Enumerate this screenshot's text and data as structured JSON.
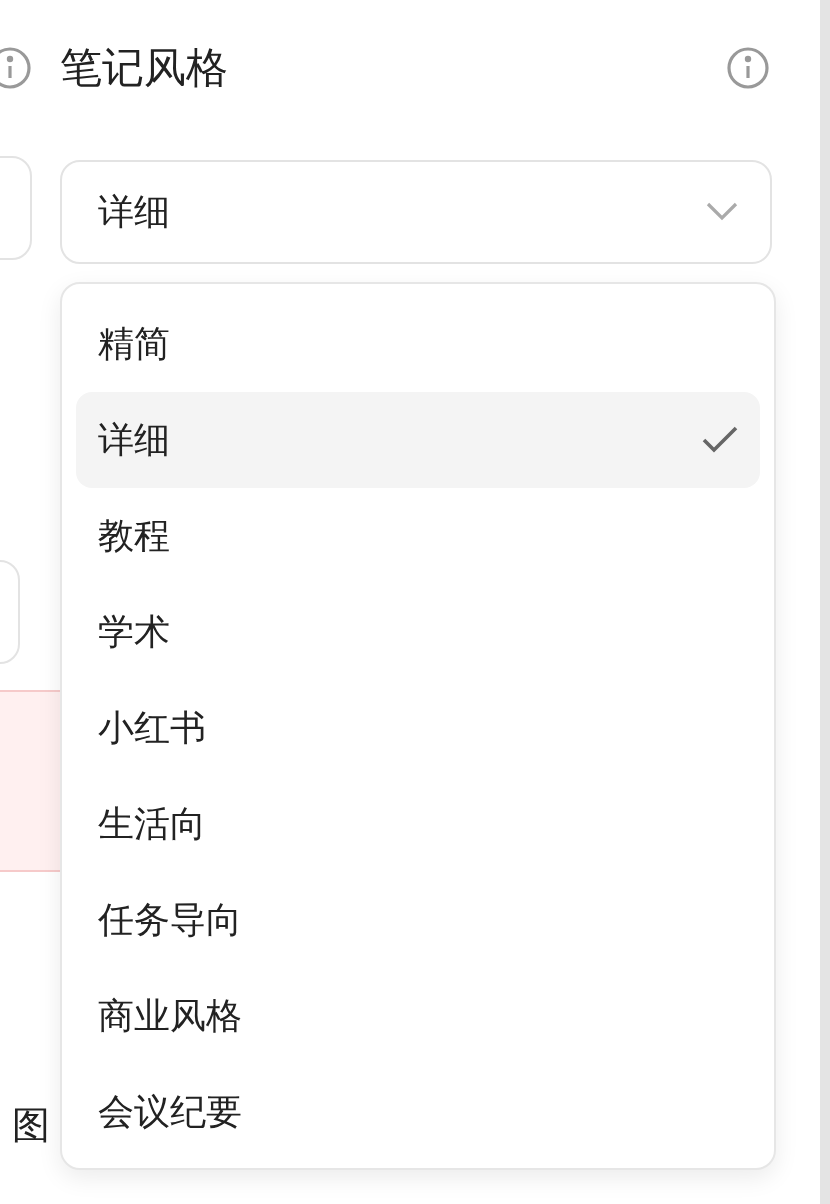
{
  "side_panel": {
    "caption_fragment": "图"
  },
  "note_style": {
    "title": "笔记风格",
    "select": {
      "value": "详细",
      "expanded": true
    },
    "options": [
      {
        "label": "精简",
        "selected": false
      },
      {
        "label": "详细",
        "selected": true
      },
      {
        "label": "教程",
        "selected": false
      },
      {
        "label": "学术",
        "selected": false
      },
      {
        "label": "小红书",
        "selected": false
      },
      {
        "label": "生活向",
        "selected": false
      },
      {
        "label": "任务导向",
        "selected": false
      },
      {
        "label": "商业风格",
        "selected": false
      },
      {
        "label": "会议纪要",
        "selected": false
      }
    ]
  }
}
